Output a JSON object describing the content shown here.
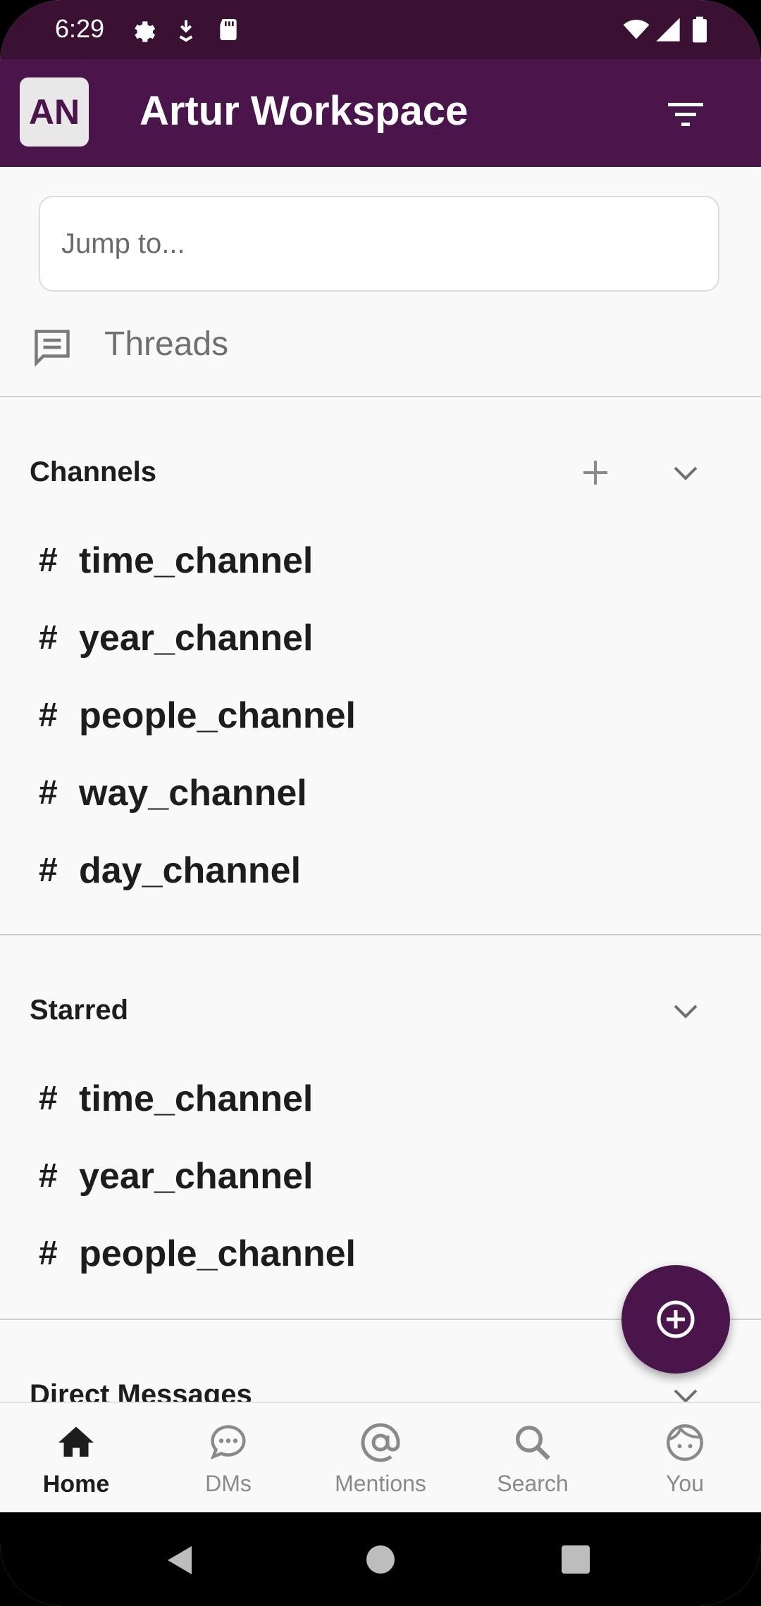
{
  "status_bar": {
    "time": "6:29"
  },
  "header": {
    "avatar_initials": "AN",
    "workspace_name": "Artur Workspace"
  },
  "jump": {
    "placeholder": "Jump to..."
  },
  "threads": {
    "label": "Threads"
  },
  "channels": {
    "title": "Channels",
    "items": [
      "time_channel",
      "year_channel",
      "people_channel",
      "way_channel",
      "day_channel"
    ]
  },
  "starred": {
    "title": "Starred",
    "items": [
      "time_channel",
      "year_channel",
      "people_channel"
    ]
  },
  "direct_messages": {
    "title": "Direct Messages"
  },
  "hash_symbol": "#",
  "bottom_nav": {
    "home": "Home",
    "dms": "DMs",
    "mentions": "Mentions",
    "search": "Search",
    "you": "You"
  },
  "colors": {
    "brand": "#4a154b",
    "status_bar": "#3a1133"
  }
}
